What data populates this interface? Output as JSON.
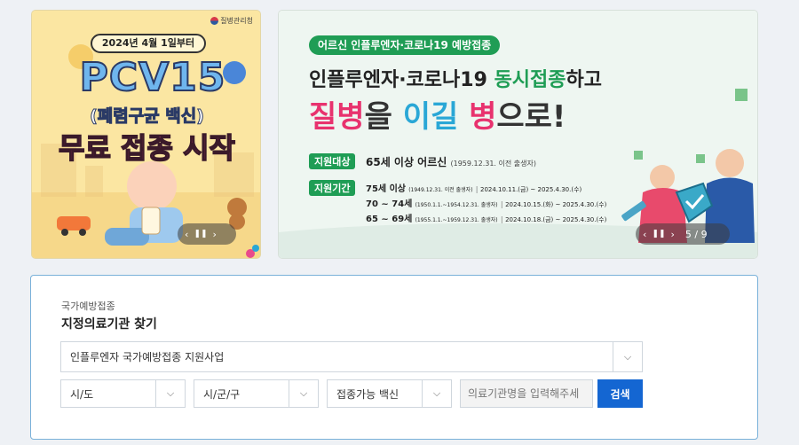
{
  "banner_left": {
    "agency": "질병관리청",
    "date_ribbon": "2024년 4월 1일부터",
    "vaccine": "PCV15",
    "vaccine_sub": "(폐렴구균 백신)",
    "headline": "무료 접종 시작"
  },
  "banner_right": {
    "pill": "어르신 인플루엔자·코로나19 예방접종",
    "line1_pre": "인플루엔자·코로나19 ",
    "line1_accent": "동시접종",
    "line1_post": "하고",
    "line2": [
      "질병",
      "을 ",
      "이길",
      " 병",
      "으로!"
    ],
    "target_label": "지원대상",
    "target_value": "65세 이상 어르신",
    "target_note": "(1959.12.31. 이전 출생자)",
    "period_label": "지원기간",
    "periods": [
      {
        "age": "75세 이상",
        "born": "(1949.12.31. 이전 출생자)",
        "range": "2024.10.11.(금) ~ 2025.4.30.(수)"
      },
      {
        "age": "70 ~ 74세",
        "born": "(1950.1.1.~1954.12.31. 출생자)",
        "range": "2024.10.15.(화) ~ 2025.4.30.(수)"
      },
      {
        "age": "65 ~ 69세",
        "born": "(1955.1.1.~1959.12.31. 출생자)",
        "range": "2024.10.18.(금) ~ 2025.4.30.(수)"
      }
    ],
    "counter": "5 / 9"
  },
  "search": {
    "category": "국가예방접종",
    "title": "지정의료기관 찾기",
    "program_selected": "인플루엔자 국가예방접종 지원사업",
    "sido": "시/도",
    "sigungu": "시/군/구",
    "vaccine": "접종가능 백신",
    "name_placeholder": "의료기관명을 입력해주세",
    "search_button": "검색"
  },
  "colors": {
    "primary": "#1466d2",
    "border": "#79b1d9",
    "accent_green": "#1f9d55",
    "accent_pink": "#e8326e",
    "accent_blue": "#2aa7d6"
  },
  "icons": {
    "pause": "❚❚",
    "prev": "‹",
    "next": "›",
    "chevron": "⌵"
  }
}
